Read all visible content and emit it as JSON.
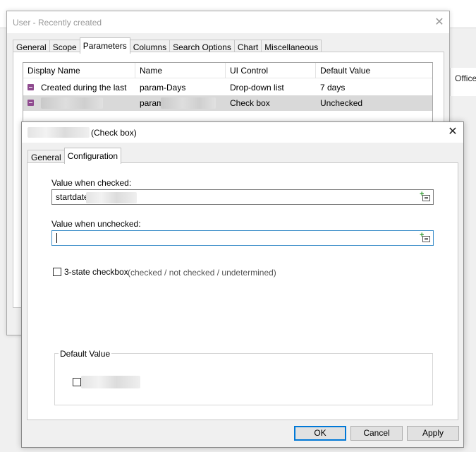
{
  "background_app": {
    "right_pane_label": "Office"
  },
  "outer_dialog": {
    "title": "User - Recently created",
    "close_glyph": "✕",
    "tabs": [
      {
        "label": "General",
        "active": false
      },
      {
        "label": "Scope",
        "active": false
      },
      {
        "label": "Parameters",
        "active": true
      },
      {
        "label": "Columns",
        "active": false
      },
      {
        "label": "Search Options",
        "active": false
      },
      {
        "label": "Chart",
        "active": false
      },
      {
        "label": "Miscellaneous",
        "active": false
      }
    ],
    "grid": {
      "columns": [
        "Display Name",
        "Name",
        "UI Control",
        "Default Value"
      ],
      "rows": [
        {
          "display_name": "Created during the last",
          "name": "param-Days",
          "ui_control": "Drop-down list",
          "default_value": "7 days",
          "selected": false
        },
        {
          "display_name": "",
          "name": "param",
          "ui_control": "Check box",
          "default_value": "Unchecked",
          "selected": true
        }
      ]
    }
  },
  "inner_dialog": {
    "title_suffix": "(Check box)",
    "close_glyph": "✕",
    "tabs": [
      {
        "label": "General",
        "active": false
      },
      {
        "label": "Configuration",
        "active": true
      }
    ],
    "value_when_checked": {
      "label": "Value when checked:",
      "value": "startdate"
    },
    "value_when_unchecked": {
      "label": "Value when unchecked:",
      "value": ""
    },
    "three_state": {
      "label": "3-state checkbox",
      "hint": "(checked / not checked / undetermined)",
      "checked": false
    },
    "default_value_group": {
      "title": "Default Value",
      "checked": false
    },
    "buttons": {
      "ok": "OK",
      "cancel": "Cancel",
      "apply": "Apply"
    }
  },
  "colors": {
    "selected_row": "#d9d9d9",
    "focus_border": "#3d8ec9",
    "default_button_border": "#0078d7",
    "row_icon": "#8f4b8f"
  }
}
